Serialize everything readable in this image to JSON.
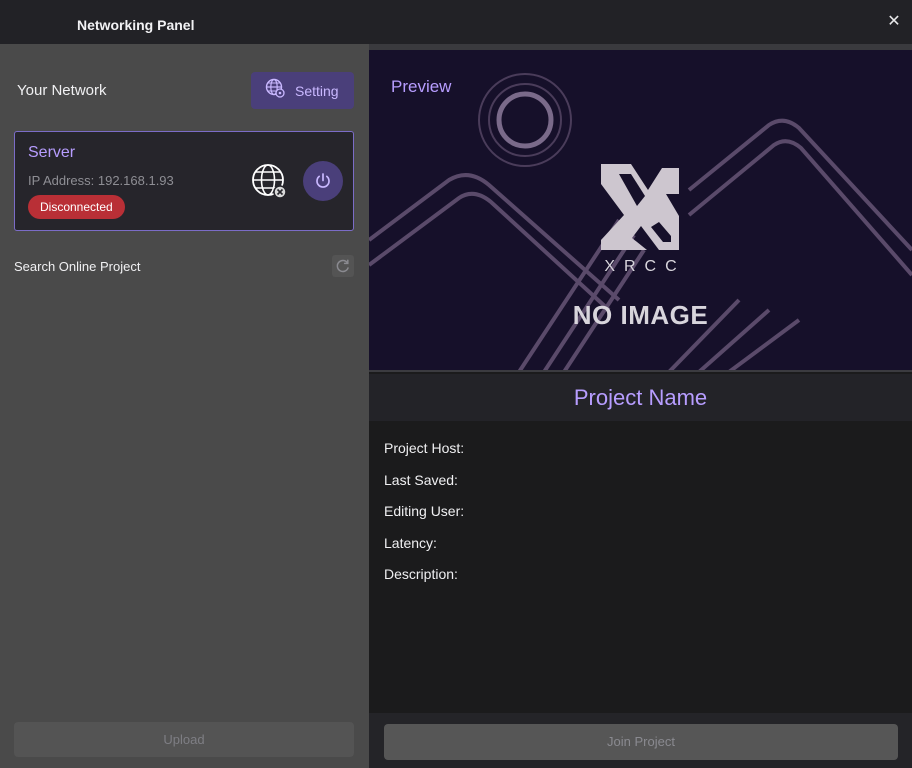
{
  "window": {
    "title": "Networking Panel",
    "close_icon": "close-icon"
  },
  "left": {
    "network_label": "Your Network",
    "setting_button": {
      "label": "Setting",
      "icon": "globe-settings-icon"
    },
    "server": {
      "title": "Server",
      "ip": "IP Address: 192.168.1.93",
      "status": "Disconnected",
      "status_color": "#b92f36",
      "globe_icon": "globe-disconnected-icon",
      "power_icon": "power-icon"
    },
    "search_label": "Search Online Project",
    "refresh_icon": "refresh-icon",
    "upload_label": "Upload"
  },
  "right": {
    "preview_label": "Preview",
    "logo_text": "XRCC",
    "no_image": "NO IMAGE",
    "project_name": "Project Name",
    "fields": [
      "Project Host:",
      "Last Saved:",
      "Editing User:",
      "Latency:",
      "Description:"
    ],
    "join_label": "Join Project"
  },
  "colors": {
    "accent": "#b79dff",
    "button": "#4a3f7a",
    "danger": "#b92f36"
  }
}
